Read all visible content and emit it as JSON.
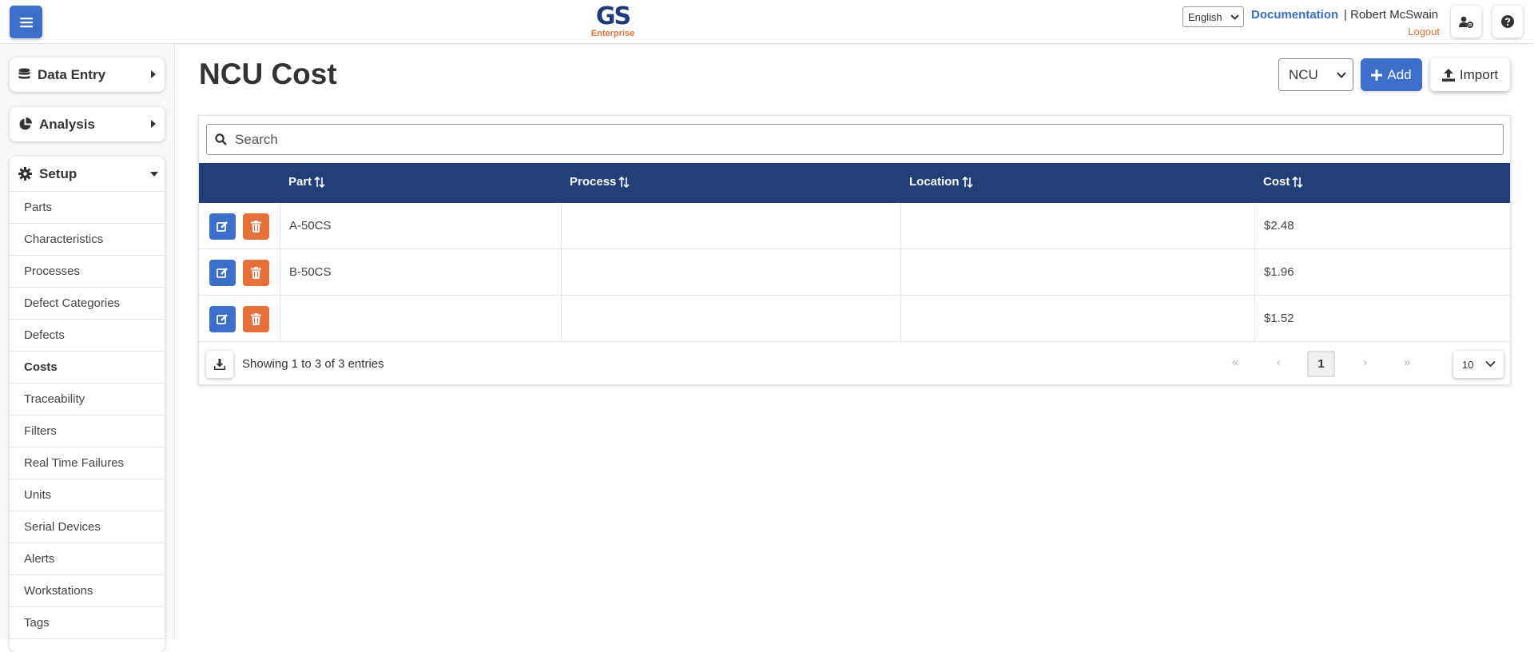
{
  "header": {
    "logo_main": "GS",
    "logo_sub": "Enterprise",
    "language": "English",
    "documentation_label": "Documentation",
    "separator": "|",
    "user_name": "Robert McSwain",
    "logout_label": "Logout"
  },
  "sidebar": {
    "data_entry_label": "Data Entry",
    "analysis_label": "Analysis",
    "setup_label": "Setup",
    "setup_items": [
      {
        "label": "Parts"
      },
      {
        "label": "Characteristics"
      },
      {
        "label": "Processes"
      },
      {
        "label": "Defect Categories"
      },
      {
        "label": "Defects"
      },
      {
        "label": "Costs"
      },
      {
        "label": "Traceability"
      },
      {
        "label": "Filters"
      },
      {
        "label": "Real Time Failures"
      },
      {
        "label": "Units"
      },
      {
        "label": "Serial Devices"
      },
      {
        "label": "Alerts"
      },
      {
        "label": "Workstations"
      },
      {
        "label": "Tags"
      }
    ],
    "active_item": "Costs"
  },
  "main": {
    "title": "NCU Cost",
    "type_select_value": "NCU",
    "add_label": "Add",
    "import_label": "Import",
    "search_placeholder": "Search",
    "columns": [
      "Part",
      "Process",
      "Location",
      "Cost"
    ],
    "rows": [
      {
        "part": "A-50CS",
        "process": "",
        "location": "",
        "cost": "$2.48"
      },
      {
        "part": "B-50CS",
        "process": "",
        "location": "",
        "cost": "$1.96"
      },
      {
        "part": "",
        "process": "",
        "location": "",
        "cost": "$1.52"
      }
    ],
    "showing_text": "Showing 1 to 3 of 3 entries",
    "pagination": {
      "first": "«",
      "prev": "‹",
      "current": "1",
      "next": "›",
      "last": "»"
    },
    "per_page": "10"
  },
  "colors": {
    "primary": "#3d6ec9",
    "header_navy": "#223f77",
    "accent_orange": "#e5703a"
  }
}
